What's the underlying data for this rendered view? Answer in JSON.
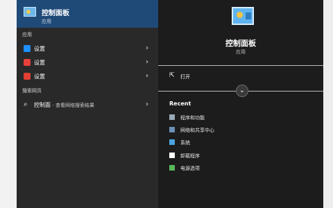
{
  "best_match": {
    "title": "控制面板",
    "subtitle": "应用"
  },
  "sections": {
    "apps": "应用",
    "web": "搜索网页"
  },
  "apps": [
    {
      "label": "设置",
      "icon": "gear-icon",
      "color": "#1e90ff"
    },
    {
      "label": "设置",
      "icon": "tool-icon",
      "color": "#e8403a"
    },
    {
      "label": "设置",
      "icon": "s-app-icon",
      "color": "#e24032"
    }
  ],
  "web_result": {
    "query": "控制面",
    "suffix": " - 查看网络搜索结果"
  },
  "preview": {
    "title": "控制面板",
    "subtitle": "应用",
    "open_label": "打开",
    "recent_heading": "Recent",
    "recent": [
      {
        "label": "程序和功能",
        "icon": "programs-icon",
        "color": "#9aa9b8"
      },
      {
        "label": "网络和共享中心",
        "icon": "network-icon",
        "color": "#6b8fb5"
      },
      {
        "label": "系统",
        "icon": "system-icon",
        "color": "#4aa3df"
      },
      {
        "label": "卸载程序",
        "icon": "document-icon",
        "color": "#ffffff"
      },
      {
        "label": "电源选项",
        "icon": "battery-icon",
        "color": "#58b85b"
      }
    ]
  }
}
